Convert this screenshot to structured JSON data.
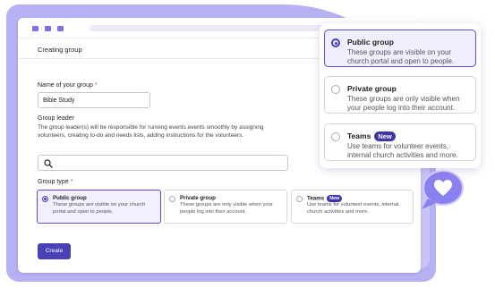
{
  "colors": {
    "accent": "#4b40b5",
    "background_shape": "#b6b1f2",
    "required": "#d04040"
  },
  "window": {
    "dots": 3
  },
  "page": {
    "title": "Creating group"
  },
  "form": {
    "name_label": "Name of your group",
    "name_required_mark": "*",
    "name_value": "Bible Study",
    "leader_label": "Group leader",
    "leader_help": "The group leader(s) will be responsible for running events events smoothly by assigning volunteers, creating to-do and needs lists, adding instructions for the volunteers.",
    "leader_search_value": "",
    "type_label": "Group type",
    "type_required_mark": "*",
    "options": [
      {
        "title": "Public group",
        "description": "These groups are visible on your church portal and open to people.",
        "selected": true
      },
      {
        "title": "Private group",
        "description": "These groups are only visible when your people log into their account.",
        "selected": false
      },
      {
        "title": "Teams",
        "badge": "New",
        "description": "Use teams for volunteer events, internal church activities and more.",
        "selected": false
      }
    ],
    "create_label": "Create"
  },
  "icons": [
    "search-icon",
    "heart-icon"
  ]
}
